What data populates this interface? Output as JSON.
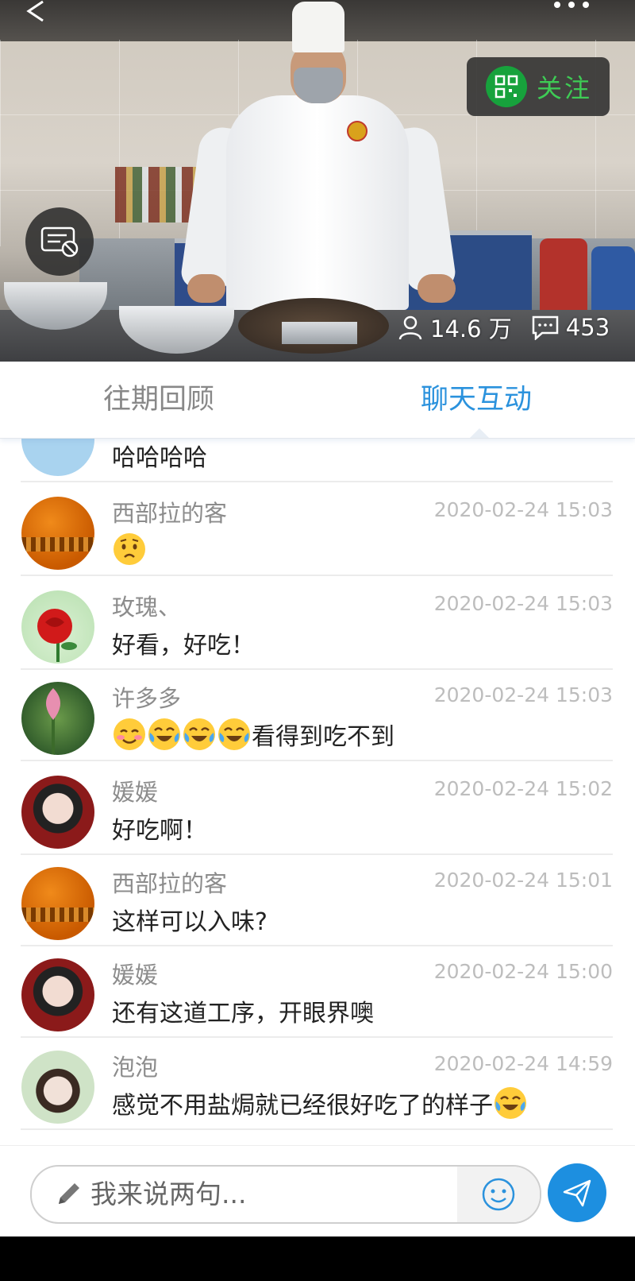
{
  "video": {
    "follow_label": "关注",
    "viewers": "14.6 万",
    "comments": "453"
  },
  "tabs": [
    {
      "label": "往期回顾"
    },
    {
      "label": "聊天互动"
    }
  ],
  "chat": {
    "partial_text": "哈哈哈哈",
    "messages": [
      {
        "name": "西部拉的客",
        "time": "2020-02-24 15:03",
        "text": "",
        "emojis": [
          "worried"
        ]
      },
      {
        "name": "玫瑰、",
        "time": "2020-02-24 15:03",
        "text": "好看，好吃！",
        "emojis": []
      },
      {
        "name": "许多多",
        "time": "2020-02-24 15:03",
        "text": "看得到吃不到",
        "emojis": [
          "blush",
          "tears-of-joy",
          "tears-of-joy",
          "tears-of-joy"
        ]
      },
      {
        "name": "媛媛",
        "time": "2020-02-24 15:02",
        "text": "好吃啊！",
        "emojis": []
      },
      {
        "name": "西部拉的客",
        "time": "2020-02-24 15:01",
        "text": "这样可以入味?",
        "emojis": []
      },
      {
        "name": "媛媛",
        "time": "2020-02-24 15:00",
        "text": "还有这道工序，开眼界噢",
        "emojis": []
      },
      {
        "name": "泡泡",
        "time": "2020-02-24 14:59",
        "text": "感觉不用盐焗就已经很好吃了的样子",
        "emojis": [
          "tears-of-joy"
        ]
      }
    ]
  },
  "input": {
    "placeholder": "我来说两句..."
  },
  "colors": {
    "accent": "#2b92dd",
    "follow_green": "#17a23c",
    "send_blue": "#1d8fe0"
  }
}
